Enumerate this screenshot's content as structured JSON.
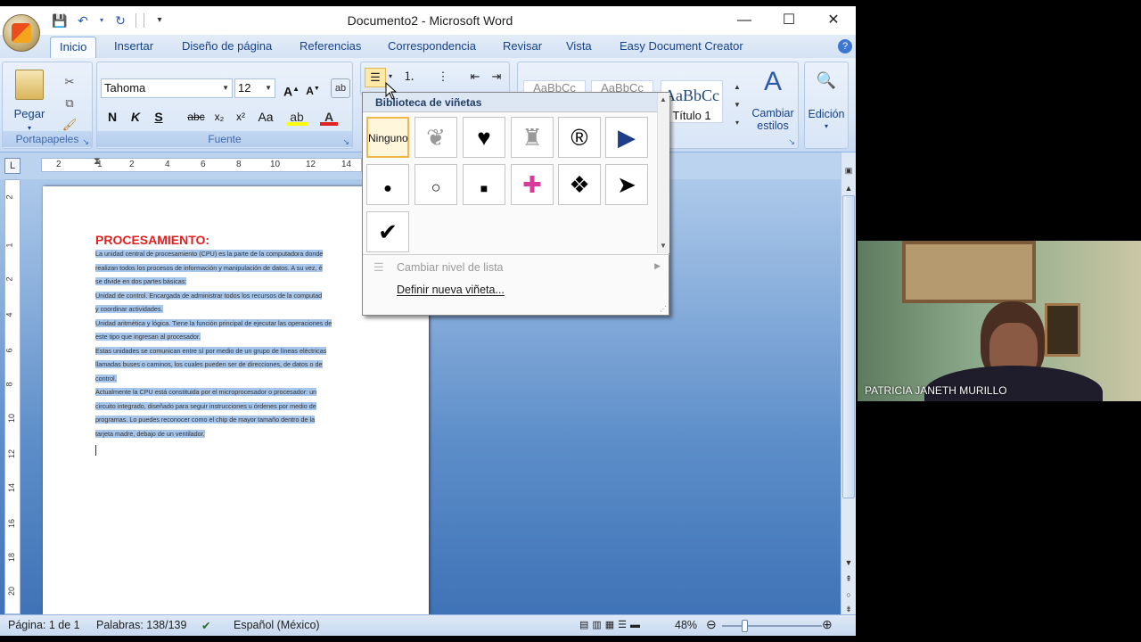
{
  "window": {
    "title": "Documento2 - Microsoft Word"
  },
  "tabs": [
    "Inicio",
    "Insertar",
    "Diseño de página",
    "Referencias",
    "Correspondencia",
    "Revisar",
    "Vista",
    "Easy Document Creator"
  ],
  "ribbon": {
    "clipboard": {
      "paste_label": "Pegar",
      "group_label": "Portapapeles"
    },
    "font": {
      "font_name": "Tahoma",
      "font_size": "12",
      "group_label": "Fuente",
      "bold": "N",
      "italic": "K",
      "underline": "S",
      "strike": "abc",
      "sub": "x₂",
      "sup": "x²",
      "case": "Aa"
    },
    "styles": {
      "preview_text": "AaBbCc",
      "heading1_label": "Título 1",
      "change_styles_label": "Cambiar estilos"
    },
    "editing": {
      "label": "Edición"
    }
  },
  "ruler": {
    "marks": [
      "2",
      "1",
      "2",
      "4",
      "6",
      "8",
      "10",
      "12",
      "14"
    ],
    "vmarks": [
      "2",
      "1",
      "2",
      "4",
      "6",
      "8",
      "10",
      "12",
      "14",
      "16",
      "18",
      "20"
    ]
  },
  "document": {
    "heading": "PROCESAMIENTO:",
    "paragraphs": [
      "La unidad central de procesamiento (CPU) es la parte de la computadora donde",
      "realizan todos los procesos de información y manipulación de datos. A su vez, é",
      "se divide en dos partes básicas:",
      "Unidad de control. Encargada de administrar todos los recursos de la computad",
      "y coordinar actividades.",
      "Unidad aritmética y lógica. Tiene la función principal de ejecutar las operaciones de",
      "este tipo que ingresan al procesador.",
      "Estas unidades se comunican entre sí por medio de un grupo de líneas eléctricas",
      "llamadas buses o caminos, los cuales pueden ser de direcciones, de datos o de",
      "control.",
      "Actualmente la CPU está constituida por el microprocesador o procesador: un",
      "circuito integrado, diseñado para seguir instrucciones u órdenes por medio de",
      "programas. Lo puedes reconocer como el chip de mayor tamaño dentro de la",
      "tarjeta madre, debajo de un ventilador."
    ]
  },
  "bullet_menu": {
    "header": "Biblioteca de viñetas",
    "items": [
      {
        "label": "Ninguno",
        "glyph": "",
        "icon": "none",
        "selected": true
      },
      {
        "label": "",
        "glyph": "❦",
        "icon": "picture-bullet-icon"
      },
      {
        "label": "",
        "glyph": "♥",
        "icon": "heart-icon"
      },
      {
        "label": "",
        "glyph": "♜",
        "icon": "picture-bullet-icon"
      },
      {
        "label": "",
        "glyph": "®",
        "icon": "registered-icon"
      },
      {
        "label": "",
        "glyph": "▶",
        "icon": "triangle-icon"
      },
      {
        "label": "",
        "glyph": "●",
        "icon": "filled-circle-icon"
      },
      {
        "label": "",
        "glyph": "○",
        "icon": "hollow-circle-icon"
      },
      {
        "label": "",
        "glyph": "■",
        "icon": "square-icon"
      },
      {
        "label": "",
        "glyph": "✚",
        "icon": "color-cross-icon"
      },
      {
        "label": "",
        "glyph": "❖",
        "icon": "diamonds-icon"
      },
      {
        "label": "",
        "glyph": "➤",
        "icon": "arrowhead-icon"
      },
      {
        "label": "",
        "glyph": "✔",
        "icon": "checkmark-icon"
      }
    ],
    "change_level": "Cambiar nivel de lista",
    "define_new": "Definir nueva viñeta..."
  },
  "status": {
    "page": "Página: 1 de 1",
    "words": "Palabras: 138/139",
    "language": "Español (México)",
    "zoom": "48%",
    "zoom_fraction": 0.2
  },
  "webcam": {
    "name": "PATRICIA JANETH MURILLO"
  },
  "colors": {
    "heading_red": "#e0201f",
    "selection": "#a7c6ec",
    "ribbon_blue": "#15428b"
  }
}
